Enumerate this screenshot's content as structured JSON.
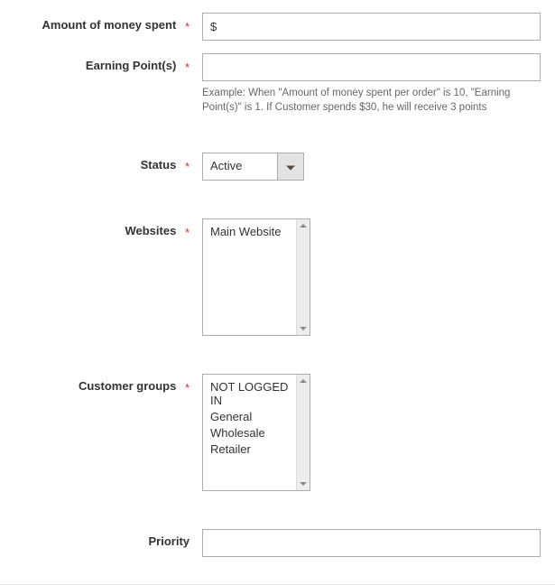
{
  "fields": {
    "amount_spent": {
      "label": "Amount of money spent",
      "required_mark": "*",
      "value": "$"
    },
    "earning_points": {
      "label": "Earning Point(s)",
      "required_mark": "*",
      "value": "",
      "help": "Example: When \"Amount of money spent per order\" is 10, \"Earning Point(s)\" is 1. If Customer spends $30, he will receive 3 points"
    },
    "status": {
      "label": "Status",
      "required_mark": "*",
      "selected": "Active"
    },
    "websites": {
      "label": "Websites",
      "required_mark": "*",
      "options": [
        "Main Website"
      ]
    },
    "customer_groups": {
      "label": "Customer groups",
      "required_mark": "*",
      "options": [
        "NOT LOGGED IN",
        "General",
        "Wholesale",
        "Retailer"
      ]
    },
    "priority": {
      "label": "Priority",
      "value": ""
    }
  }
}
